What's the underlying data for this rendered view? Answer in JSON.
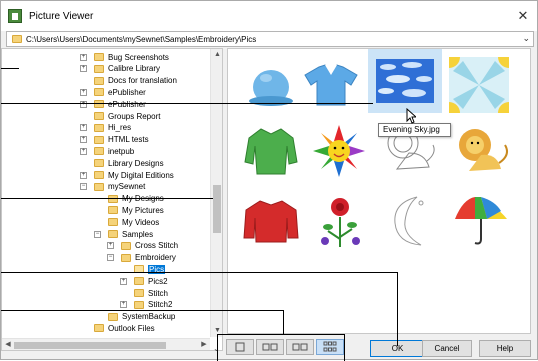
{
  "window": {
    "title": "Picture Viewer",
    "close_glyph": "✕"
  },
  "path": {
    "value": "C:\\Users\\Users\\Documents\\mySewnet\\Samples\\Embroidery\\Pics",
    "dropdown_glyph": "⌄"
  },
  "tree": {
    "items": [
      {
        "label": "Bug Screenshots",
        "expander": "+",
        "level": 0
      },
      {
        "label": "Calibre Library",
        "expander": "+",
        "level": 0
      },
      {
        "label": "Docs for translation",
        "expander": "",
        "level": 0
      },
      {
        "label": "ePublisher",
        "expander": "+",
        "level": 0
      },
      {
        "label": "ePublisher",
        "expander": "+",
        "level": 0
      },
      {
        "label": "Groups Report",
        "expander": "",
        "level": 0
      },
      {
        "label": "Hi_res",
        "expander": "+",
        "level": 0
      },
      {
        "label": "HTML tests",
        "expander": "+",
        "level": 0
      },
      {
        "label": "inetpub",
        "expander": "+",
        "level": 0
      },
      {
        "label": "Library Designs",
        "expander": "",
        "level": 0
      },
      {
        "label": "My Digital Editions",
        "expander": "+",
        "level": 0
      },
      {
        "label": "mySewnet",
        "expander": "−",
        "level": 0
      },
      {
        "label": "My Designs",
        "expander": "",
        "level": 1
      },
      {
        "label": "My Pictures",
        "expander": "",
        "level": 1
      },
      {
        "label": "My Videos",
        "expander": "",
        "level": 1
      },
      {
        "label": "Samples",
        "expander": "−",
        "level": 1
      },
      {
        "label": "Cross Stitch",
        "expander": "+",
        "level": 2
      },
      {
        "label": "Embroidery",
        "expander": "−",
        "level": 2
      },
      {
        "label": "Pics",
        "expander": "",
        "level": 3,
        "selected": true
      },
      {
        "label": "Pics2",
        "expander": "+",
        "level": 3
      },
      {
        "label": "Stitch",
        "expander": "",
        "level": 3
      },
      {
        "label": "Stitch2",
        "expander": "+",
        "level": 3
      },
      {
        "label": "SystemBackup",
        "expander": "",
        "level": 1
      },
      {
        "label": "Outlook Files",
        "expander": "",
        "level": 0
      }
    ]
  },
  "scroll": {
    "up": "▲",
    "down": "▼",
    "left": "◀",
    "right": "▶",
    "chevron": "⌄"
  },
  "gallery": {
    "thumbnails": [
      {
        "name": "cap",
        "selected": false
      },
      {
        "name": "polo-shirt",
        "selected": false
      },
      {
        "name": "evening-sky",
        "selected": true
      },
      {
        "name": "sun-tile",
        "selected": false
      },
      {
        "name": "green-shirt",
        "selected": false
      },
      {
        "name": "sun-face",
        "selected": false
      },
      {
        "name": "lion-outline",
        "selected": false
      },
      {
        "name": "lion-color",
        "selected": false
      },
      {
        "name": "red-sweater",
        "selected": false
      },
      {
        "name": "flowers",
        "selected": false
      },
      {
        "name": "moon",
        "selected": false
      },
      {
        "name": "umbrella",
        "selected": false
      }
    ],
    "tooltip": "Evening Sky.jpg"
  },
  "view_buttons": [
    {
      "name": "view-large-button",
      "active": false
    },
    {
      "name": "view-medium-button",
      "active": false
    },
    {
      "name": "view-small-button",
      "active": false
    },
    {
      "name": "view-tiny-button",
      "active": true
    }
  ],
  "buttons": {
    "ok": "OK",
    "cancel": "Cancel",
    "help": "Help"
  },
  "colors": {
    "selection": "#0078d7",
    "thumb_selected": "#cce4f7",
    "folder": "#f5d37a"
  }
}
